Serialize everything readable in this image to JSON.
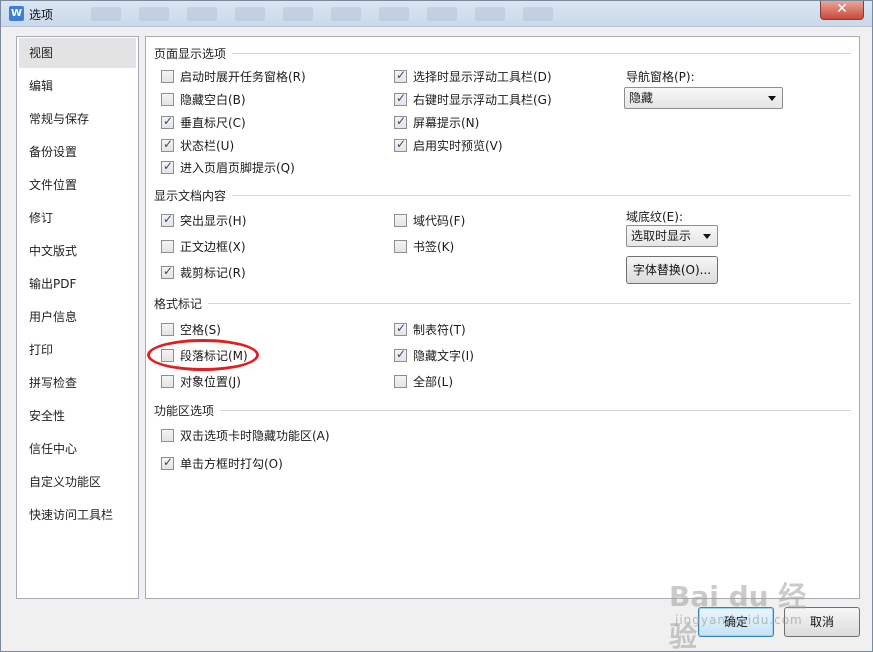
{
  "window": {
    "title": "选项",
    "close_label": "✕"
  },
  "nav": {
    "items": [
      {
        "label": "视图",
        "active": true
      },
      {
        "label": "编辑"
      },
      {
        "label": "常规与保存"
      },
      {
        "label": "备份设置"
      },
      {
        "label": "文件位置"
      },
      {
        "label": "修订"
      },
      {
        "label": "中文版式"
      },
      {
        "label": "输出PDF"
      },
      {
        "label": "用户信息"
      },
      {
        "label": "打印"
      },
      {
        "label": "拼写检查"
      },
      {
        "label": "安全性"
      },
      {
        "label": "信任中心"
      },
      {
        "label": "自定义功能区"
      },
      {
        "label": "快速访问工具栏"
      }
    ]
  },
  "page_display": {
    "title": "页面显示选项",
    "options": [
      {
        "label": "启动时展开任务窗格(R)",
        "checked": false
      },
      {
        "label": "隐藏空白(B)",
        "checked": false
      },
      {
        "label": "垂直标尺(C)",
        "checked": true
      },
      {
        "label": "状态栏(U)",
        "checked": true
      },
      {
        "label": "进入页眉页脚提示(Q)",
        "checked": true
      },
      {
        "label": "选择时显示浮动工具栏(D)",
        "checked": true
      },
      {
        "label": "右键时显示浮动工具栏(G)",
        "checked": true
      },
      {
        "label": "屏幕提示(N)",
        "checked": true
      },
      {
        "label": "启用实时预览(V)",
        "checked": true
      }
    ],
    "nav_pane_label": "导航窗格(P):",
    "nav_pane_value": "隐藏"
  },
  "doc_content": {
    "title": "显示文档内容",
    "options": [
      {
        "label": "突出显示(H)",
        "checked": true
      },
      {
        "label": "正文边框(X)",
        "checked": false
      },
      {
        "label": "裁剪标记(R)",
        "checked": true
      },
      {
        "label": "域代码(F)",
        "checked": false
      },
      {
        "label": "书签(K)",
        "checked": false
      }
    ],
    "field_shading_label": "域底纹(E):",
    "field_shading_value": "选取时显示",
    "font_replace_button": "字体替换(O)..."
  },
  "format_marks": {
    "title": "格式标记",
    "options": [
      {
        "label": "空格(S)",
        "checked": false
      },
      {
        "label": "段落标记(M)",
        "checked": false
      },
      {
        "label": "对象位置(J)",
        "checked": false
      },
      {
        "label": "制表符(T)",
        "checked": true
      },
      {
        "label": "隐藏文字(I)",
        "checked": true
      },
      {
        "label": "全部(L)",
        "checked": false
      }
    ]
  },
  "ribbon": {
    "title": "功能区选项",
    "options": [
      {
        "label": "双击选项卡时隐藏功能区(A)",
        "checked": false
      },
      {
        "label": "单击方框时打勾(O)",
        "checked": true
      }
    ]
  },
  "footer": {
    "ok_label": "确定",
    "cancel_label": "取消"
  },
  "watermark": {
    "main": "Bai du 经验",
    "sub": "jingyan.baidu.com"
  },
  "colors": {
    "highlight_ellipse": "#e02020",
    "checkmark": "#2c4b7a"
  }
}
